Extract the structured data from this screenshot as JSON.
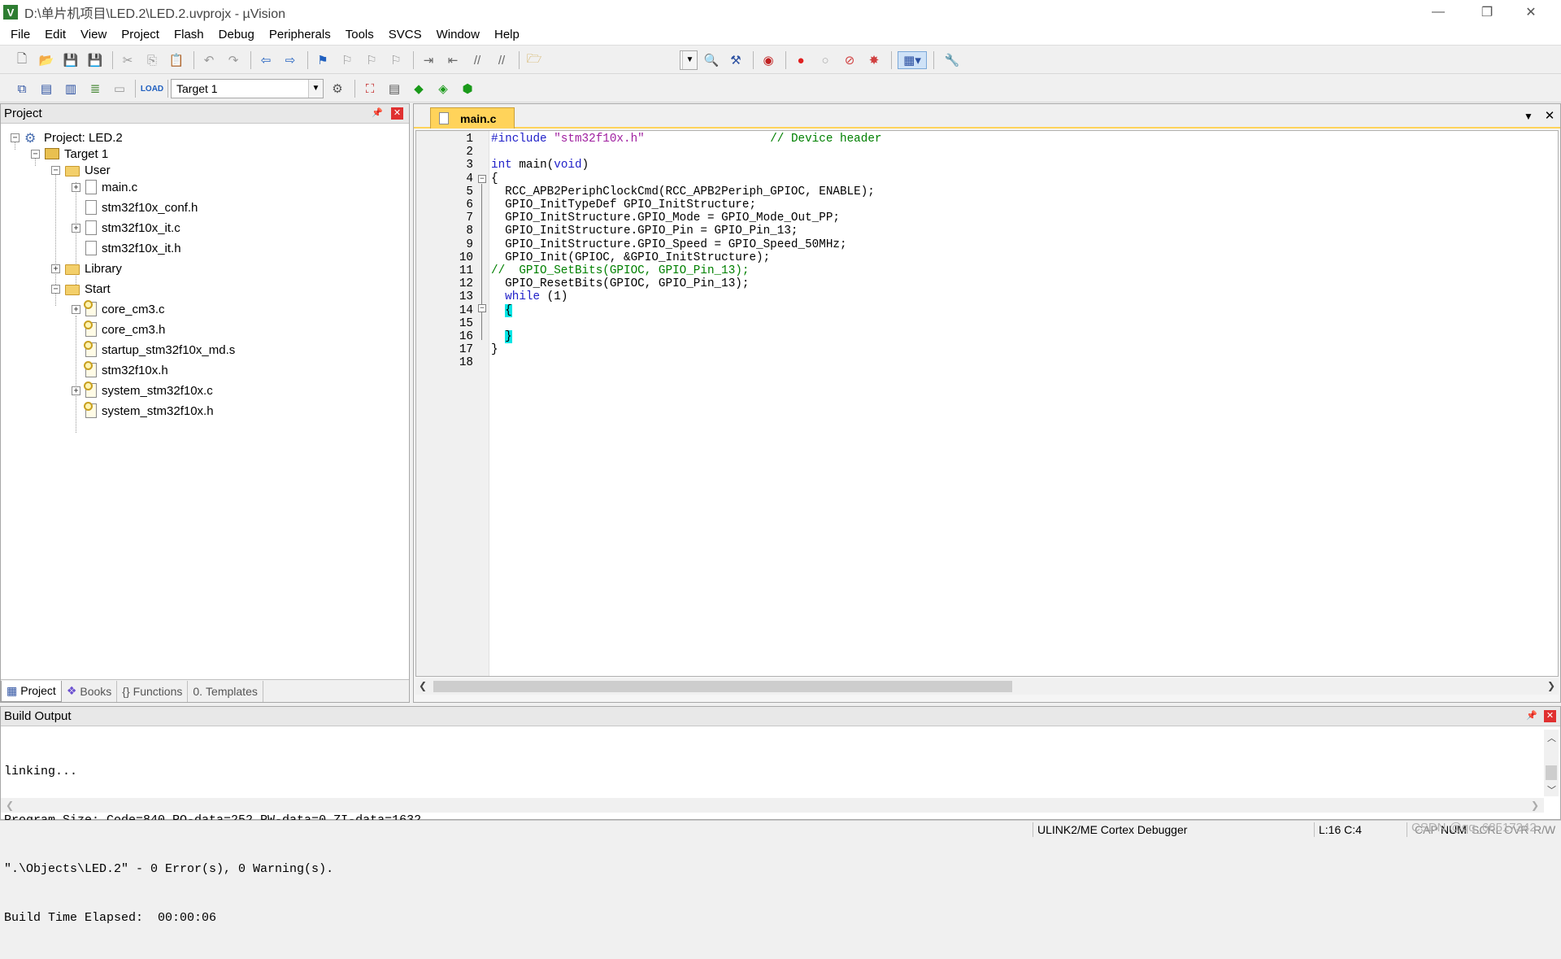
{
  "window": {
    "title": "D:\\单片机项目\\LED.2\\LED.2.uvprojx - µVision",
    "app_icon": "V",
    "minimize": "—",
    "restore": "❐",
    "close": "✕"
  },
  "menu": [
    "File",
    "Edit",
    "View",
    "Project",
    "Flash",
    "Debug",
    "Peripherals",
    "Tools",
    "SVCS",
    "Window",
    "Help"
  ],
  "toolbar2": {
    "target_select": "Target 1"
  },
  "project_panel": {
    "title": "Project",
    "tree": [
      {
        "label": "Project: LED.2",
        "icon": "project-icon",
        "expander": "−"
      },
      {
        "label": "Target 1",
        "icon": "target-folder-icon",
        "expander": "−"
      },
      {
        "label": "User",
        "icon": "folder-icon",
        "expander": "−"
      },
      {
        "label": "main.c",
        "icon": "file-icon",
        "expander": "+"
      },
      {
        "label": "stm32f10x_conf.h",
        "icon": "file-icon",
        "expander": ""
      },
      {
        "label": "stm32f10x_it.c",
        "icon": "file-icon",
        "expander": "+"
      },
      {
        "label": "stm32f10x_it.h",
        "icon": "file-icon",
        "expander": ""
      },
      {
        "label": "Library",
        "icon": "folder-icon",
        "expander": "+"
      },
      {
        "label": "Start",
        "icon": "folder-icon",
        "expander": "−"
      },
      {
        "label": "core_cm3.c",
        "icon": "key-file-icon",
        "expander": "+"
      },
      {
        "label": "core_cm3.h",
        "icon": "key-file-icon",
        "expander": ""
      },
      {
        "label": "startup_stm32f10x_md.s",
        "icon": "key-file-icon",
        "expander": ""
      },
      {
        "label": "stm32f10x.h",
        "icon": "key-file-icon",
        "expander": ""
      },
      {
        "label": "system_stm32f10x.c",
        "icon": "key-file-icon",
        "expander": "+"
      },
      {
        "label": "system_stm32f10x.h",
        "icon": "key-file-icon",
        "expander": ""
      }
    ],
    "tabs": [
      {
        "label": "Project",
        "icon": "project-tab-icon"
      },
      {
        "label": "Books",
        "icon": "books-icon"
      },
      {
        "label": "Functions",
        "icon": "functions-icon"
      },
      {
        "label": "Templates",
        "icon": "templates-icon"
      }
    ]
  },
  "editor": {
    "tab_label": "main.c",
    "lines": [
      {
        "n": "1",
        "parts": [
          [
            "kw",
            "#include "
          ],
          [
            "str",
            "\"stm32f10x.h\""
          ],
          [
            "plain",
            "                  "
          ],
          [
            "cmt",
            "// Device header"
          ]
        ]
      },
      {
        "n": "2",
        "parts": []
      },
      {
        "n": "3",
        "parts": [
          [
            "kw",
            "int"
          ],
          [
            "plain",
            " main("
          ],
          [
            "kw",
            "void"
          ],
          [
            "plain",
            ")"
          ]
        ]
      },
      {
        "n": "4",
        "parts": [
          [
            "plain",
            "{"
          ]
        ]
      },
      {
        "n": "5",
        "parts": [
          [
            "plain",
            "  RCC_APB2PeriphClockCmd(RCC_APB2Periph_GPIOC, ENABLE);"
          ]
        ]
      },
      {
        "n": "6",
        "parts": [
          [
            "plain",
            "  GPIO_InitTypeDef GPIO_InitStructure;"
          ]
        ]
      },
      {
        "n": "7",
        "parts": [
          [
            "plain",
            "  GPIO_InitStructure.GPIO_Mode = GPIO_Mode_Out_PP;"
          ]
        ]
      },
      {
        "n": "8",
        "parts": [
          [
            "plain",
            "  GPIO_InitStructure.GPIO_Pin = GPIO_Pin_13;"
          ]
        ]
      },
      {
        "n": "9",
        "parts": [
          [
            "plain",
            "  GPIO_InitStructure.GPIO_Speed = GPIO_Speed_50MHz;"
          ]
        ]
      },
      {
        "n": "10",
        "parts": [
          [
            "plain",
            "  GPIO_Init(GPIOC, &GPIO_InitStructure);"
          ]
        ]
      },
      {
        "n": "11",
        "parts": [
          [
            "cmt",
            "//  GPIO_SetBits(GPIOC, GPIO_Pin_13);"
          ]
        ]
      },
      {
        "n": "12",
        "parts": [
          [
            "plain",
            "  GPIO_ResetBits(GPIOC, GPIO_Pin_13);"
          ]
        ]
      },
      {
        "n": "13",
        "parts": [
          [
            "plain",
            "  "
          ],
          [
            "kw",
            "while"
          ],
          [
            "plain",
            " (1)"
          ]
        ]
      },
      {
        "n": "14",
        "parts": [
          [
            "plain",
            "  "
          ],
          [
            "hl",
            "{"
          ]
        ]
      },
      {
        "n": "15",
        "parts": []
      },
      {
        "n": "16",
        "parts": [
          [
            "plain",
            "  "
          ],
          [
            "hl",
            "}"
          ]
        ]
      },
      {
        "n": "17",
        "parts": [
          [
            "plain",
            "}"
          ]
        ]
      },
      {
        "n": "18",
        "parts": []
      }
    ]
  },
  "build_output": {
    "title": "Build Output",
    "lines": [
      "linking...",
      "Program Size: Code=840 RO-data=252 RW-data=0 ZI-data=1632",
      "\".\\Objects\\LED.2\" - 0 Error(s), 0 Warning(s).",
      "Build Time Elapsed:  00:00:06"
    ]
  },
  "status": {
    "debugger": "ULINK2/ME Cortex Debugger",
    "position": "L:16 C:4",
    "cap": "CAP",
    "num": "NUM",
    "scrl": "SCRL",
    "ovr": "OVR",
    "rw": "R/W",
    "watermark": "CSDN @qq_68517342"
  },
  "colors": {
    "tab_active": "#ffd35a",
    "keyword": "#1e1ec8",
    "string": "#a020a0",
    "comment": "#008000",
    "brace_highlight": "#00e5e5"
  }
}
